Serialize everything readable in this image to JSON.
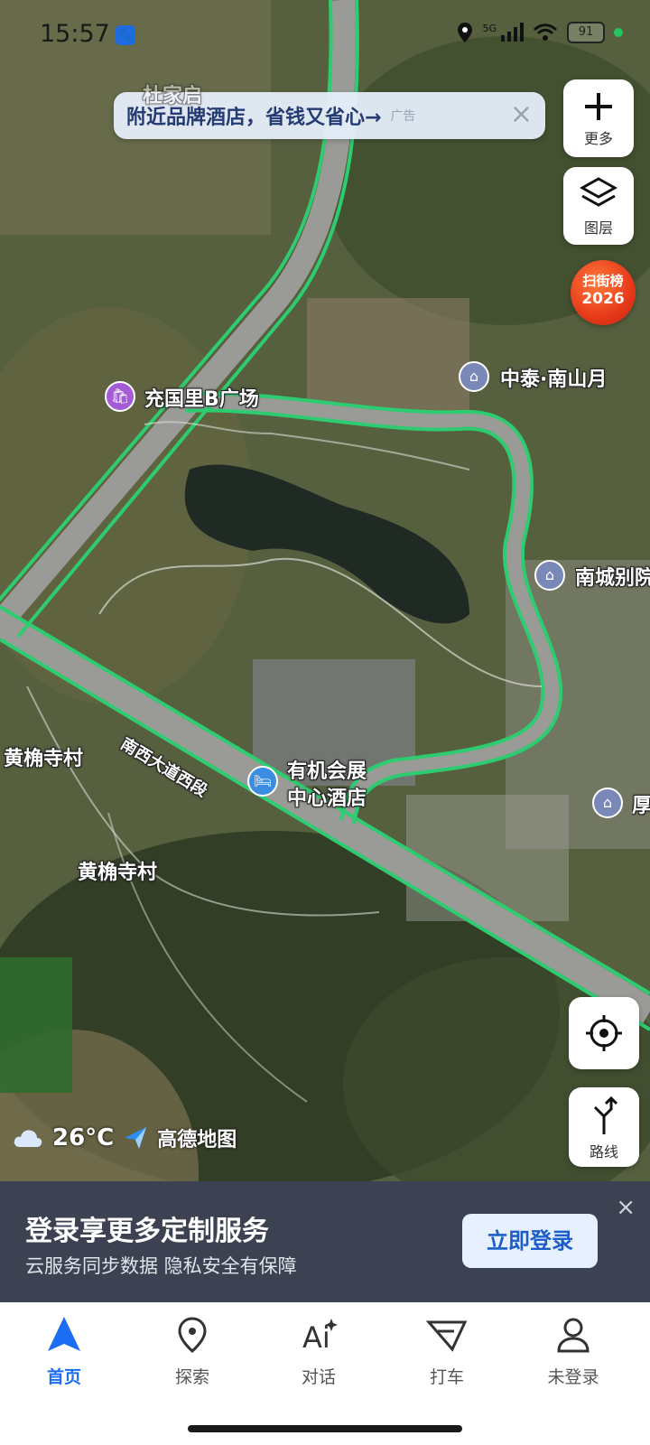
{
  "status_bar": {
    "time": "15:57",
    "network": "5G",
    "battery": "91",
    "icons": [
      "paw-icon",
      "location-icon",
      "signal-icon",
      "wifi-icon",
      "battery-icon"
    ]
  },
  "ad_banner": {
    "text": "附近品牌酒店，省钱又省心→",
    "tag": "广告",
    "close": "×"
  },
  "side_controls": {
    "more_label": "更多",
    "layers_label": "图层",
    "badge_line1": "扫街榜",
    "badge_line2": "2026",
    "route_label": "路线"
  },
  "map": {
    "labels": {
      "top_village": "杜家启",
      "plaza": "充国里B广场",
      "zhongtai": "中泰·南山月",
      "nancheng": "南城别院",
      "road": "南西大道西段",
      "hotel_line1": "有机会展",
      "hotel_line2": "中心酒店",
      "village1": "黄桷寺村",
      "village2": "黄桷寺村",
      "hou": "厚"
    },
    "colors": {
      "road_highlight": "#2ecc71",
      "road_gray": "#9a9a96",
      "water": "#1f2a24",
      "shopping_poi": "#a55bd6",
      "residential_poi": "#7a88b8",
      "hotel_poi": "#3a8de0"
    }
  },
  "weather": {
    "icon": "cloud-icon",
    "temperature": "26°C",
    "brand": "高德地图"
  },
  "login_panel": {
    "title": "登录享更多定制服务",
    "subtitle": "云服务同步数据 隐私安全有保障",
    "button": "立即登录",
    "close": "×"
  },
  "tabbar": {
    "tabs": [
      {
        "label": "首页",
        "icon": "navigation-arrow-icon",
        "active": true
      },
      {
        "label": "探索",
        "icon": "location-pin-icon",
        "active": false
      },
      {
        "label": "对话",
        "icon": "ai-icon",
        "active": false
      },
      {
        "label": "打车",
        "icon": "taxi-icon",
        "active": false
      },
      {
        "label": "未登录",
        "icon": "user-icon",
        "active": false
      }
    ]
  }
}
